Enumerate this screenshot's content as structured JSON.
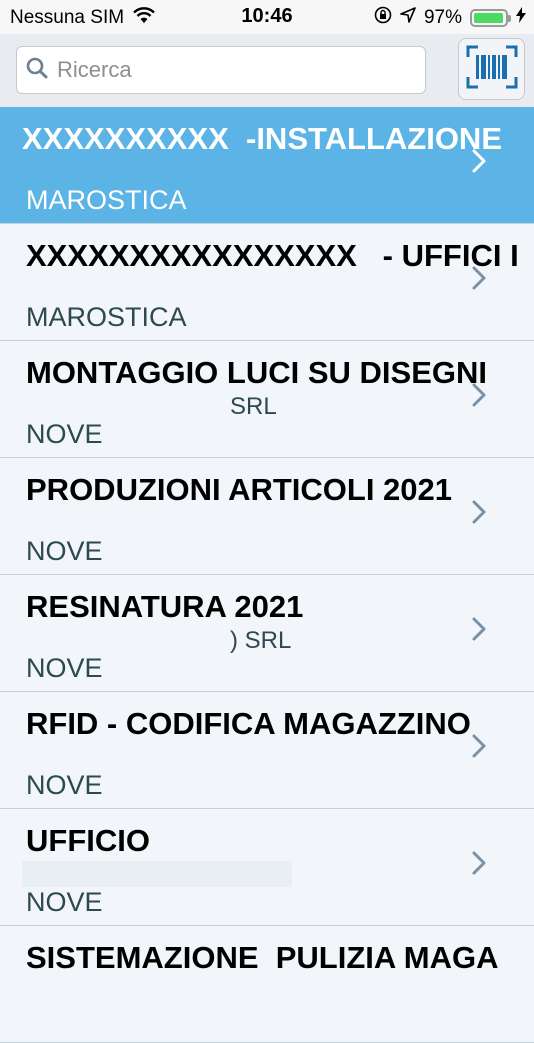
{
  "status_bar": {
    "carrier": "Nessuna SIM",
    "time": "10:46",
    "battery_percent": "97%",
    "icons": [
      "wifi-icon",
      "orientation-lock-icon",
      "location-arrow-icon",
      "battery-icon",
      "charging-bolt-icon"
    ]
  },
  "search": {
    "placeholder": "Ricerca",
    "scan_icon": "barcode-scan-icon"
  },
  "colors": {
    "selected_row": "#5bb3e6",
    "row_bg": "#f2f6fa",
    "battery_fill": "#4cd964",
    "scan_accent": "#1a6fb0"
  },
  "rows": [
    {
      "title": "XXXXXXXXXX  -INSTALLAZIONE ",
      "subtitle": "",
      "city": "MAROSTICA",
      "selected": true
    },
    {
      "title": "XXXXXXXXXXXXXXXX   - UFFICI I",
      "subtitle": "",
      "city": "MAROSTICA",
      "selected": false
    },
    {
      "title": "MONTAGGIO LUCI SU DISEGNI ",
      "subtitle": "SRL",
      "city": "NOVE",
      "selected": false
    },
    {
      "title": "PRODUZIONI ARTICOLI 2021",
      "subtitle": "",
      "city": "NOVE",
      "selected": false
    },
    {
      "title": "RESINATURA 2021",
      "subtitle": ") SRL",
      "city": "NOVE",
      "selected": false
    },
    {
      "title": "RFID - CODIFICA MAGAZZINO",
      "subtitle": "",
      "city": "NOVE",
      "selected": false
    },
    {
      "title": "UFFICIO",
      "subtitle": "",
      "city": "NOVE",
      "selected": false
    },
    {
      "title": "SISTEMAZIONE  PULIZIA MAGA",
      "subtitle": "",
      "city": "",
      "selected": false
    }
  ]
}
